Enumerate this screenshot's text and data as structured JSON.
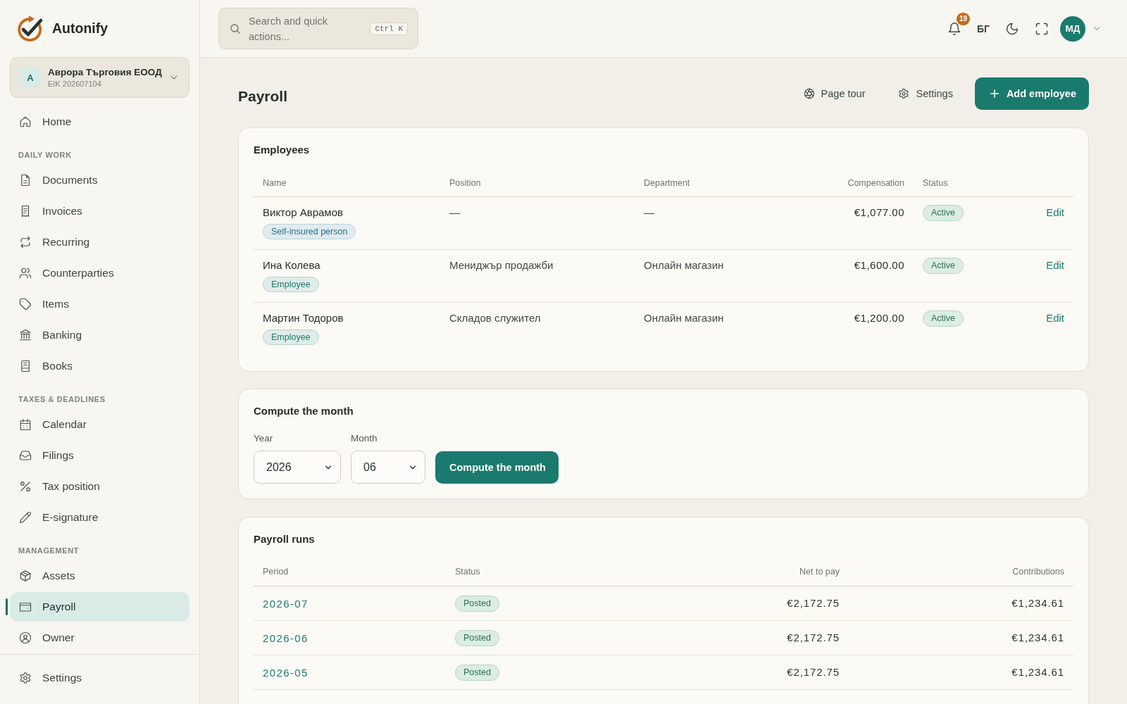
{
  "sidebar": {
    "logo": {
      "name": "Autonify"
    },
    "organization": {
      "avatar": "A",
      "name": "Аврора Търговия ЕООД",
      "tax_id": "EIK 202607104"
    },
    "sections": [
      {
        "items": [
          {
            "label": "Home",
            "selected": false
          }
        ]
      },
      {
        "title": "DAILY WORK",
        "items": [
          {
            "label": "Documents",
            "selected": false
          },
          {
            "label": "Invoices",
            "selected": false
          },
          {
            "label": "Recurring",
            "selected": false
          },
          {
            "label": "Counterparties",
            "selected": false
          },
          {
            "label": "Items",
            "selected": false
          },
          {
            "label": "Banking",
            "selected": false
          },
          {
            "label": "Books",
            "selected": false
          }
        ]
      },
      {
        "title": "TAXES & DEADLINES",
        "items": [
          {
            "label": "Calendar",
            "selected": false
          },
          {
            "label": "Filings",
            "selected": false
          },
          {
            "label": "Tax position",
            "selected": false
          },
          {
            "label": "E-signature",
            "selected": false
          }
        ]
      },
      {
        "title": "MANAGEMENT",
        "items": [
          {
            "label": "Assets",
            "selected": false
          },
          {
            "label": "Payroll",
            "selected": true
          },
          {
            "label": "Owner",
            "selected": false
          }
        ]
      }
    ],
    "footer_items": [
      {
        "label": "Settings",
        "selected": false
      }
    ]
  },
  "topbar": {
    "search": {
      "placeholder": "Search and quick actions...",
      "shortcut": "Ctrl K"
    },
    "notifications": {
      "count": "19"
    },
    "language": "БГ",
    "user": {
      "initials": "МД"
    }
  },
  "page": {
    "title": "Payroll",
    "actions": [
      {
        "label": "Page tour",
        "kind": "ghost"
      },
      {
        "label": "Settings",
        "kind": "ghost"
      },
      {
        "label": "Add employee",
        "kind": "primary"
      }
    ]
  },
  "employees": {
    "title": "Employees",
    "columns": [
      "Name",
      "Position",
      "Department",
      "Compensation",
      "Status"
    ],
    "rows": [
      {
        "name": "Виктор Аврамов",
        "type": {
          "label": "Self-insured person",
          "color": "#2c6f8e"
        },
        "position": "—",
        "department": "—",
        "compensation": "€1,077.00",
        "status": "Active",
        "action": "Edit"
      },
      {
        "name": "Ина Колева",
        "type": {
          "label": "Employee",
          "color": "#1f7a6b"
        },
        "position": "Мениджър продажби",
        "department": "Онлайн магазин",
        "compensation": "€1,600.00",
        "status": "Active",
        "action": "Edit"
      },
      {
        "name": "Мартин Тодоров",
        "type": {
          "label": "Employee",
          "color": "#1f7a6b"
        },
        "position": "Складов служител",
        "department": "Онлайн магазин",
        "compensation": "€1,200.00",
        "status": "Active",
        "action": "Edit"
      }
    ]
  },
  "compute": {
    "title": "Compute the month",
    "fields": [
      {
        "label": "Year",
        "value": "2026"
      },
      {
        "label": "Month",
        "value": "06"
      }
    ],
    "button": "Compute the month"
  },
  "payroll_runs": {
    "title": "Payroll runs",
    "columns": [
      "Period",
      "Status",
      "Net to pay",
      "Contributions"
    ],
    "rows": [
      {
        "period": "2026-07",
        "status": "Posted",
        "net_to_pay": "€2,172.75",
        "contributions": "€1,234.61"
      },
      {
        "period": "2026-06",
        "status": "Posted",
        "net_to_pay": "€2,172.75",
        "contributions": "€1,234.61"
      },
      {
        "period": "2026-05",
        "status": "Posted",
        "net_to_pay": "€2,172.75",
        "contributions": "€1,234.61"
      }
    ]
  }
}
